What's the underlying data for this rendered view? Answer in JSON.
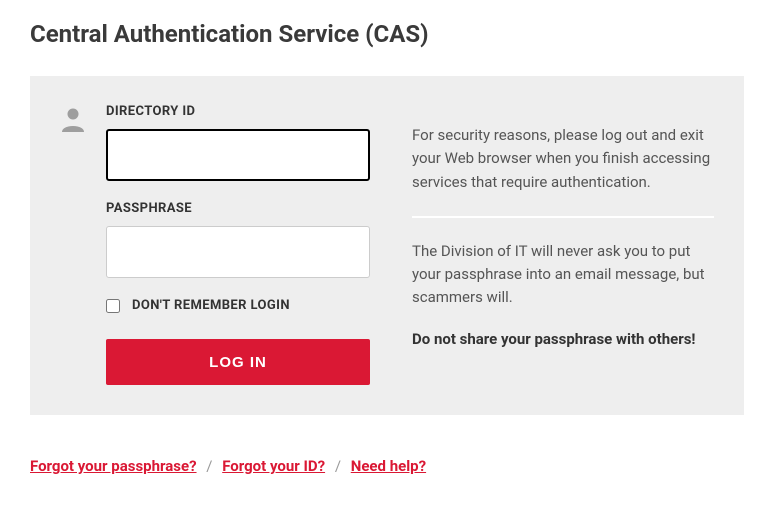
{
  "page_title": "Central Authentication Service (CAS)",
  "form": {
    "directory_id_label": "DIRECTORY ID",
    "directory_id_value": "",
    "passphrase_label": "PASSPHRASE",
    "passphrase_value": "",
    "remember_label": "DON'T REMEMBER LOGIN",
    "login_button": "LOG IN"
  },
  "info": {
    "security_notice": "For security reasons, please log out and exit your Web browser when you finish accessing services that require authentication.",
    "scam_notice": "The Division of IT will never ask you to put your passphrase into an email message, but scammers will.",
    "share_warning": "Do not share your passphrase with others!"
  },
  "footer": {
    "forgot_passphrase": "Forgot your passphrase?",
    "forgot_id": "Forgot your ID?",
    "need_help": "Need help?"
  },
  "colors": {
    "accent": "#da1834",
    "panel_bg": "#eeeeee"
  }
}
